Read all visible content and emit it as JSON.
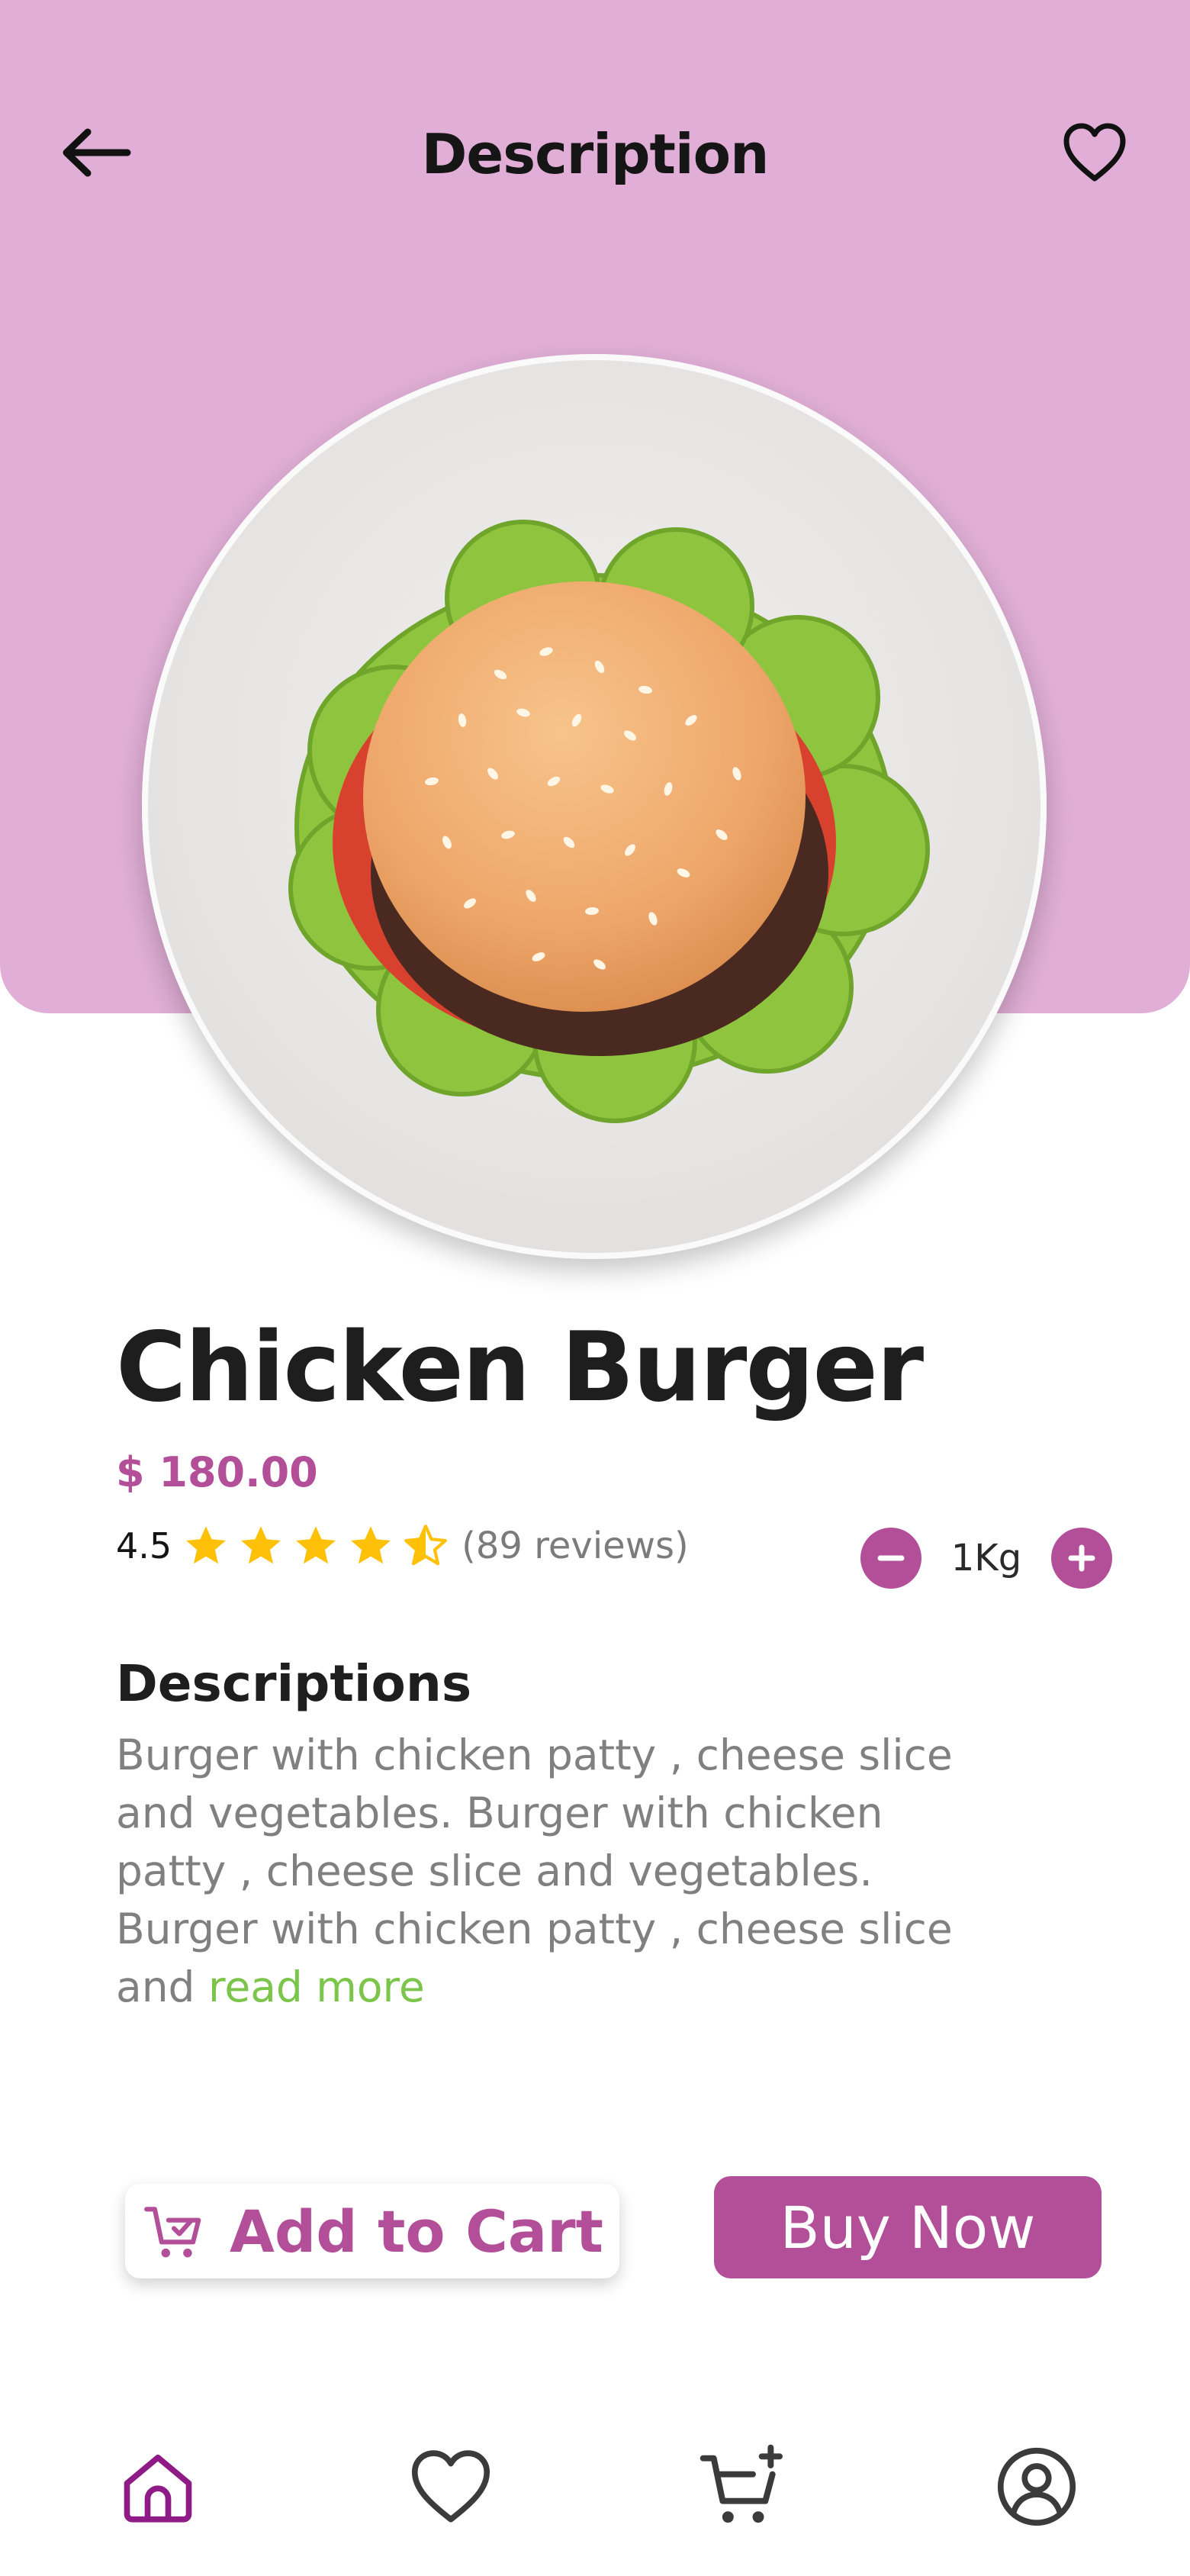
{
  "header": {
    "title": "Description",
    "back_icon": "arrow-left-icon",
    "favorite_icon": "heart-outline-icon"
  },
  "product": {
    "name": "Chicken Burger",
    "price": "$ 180.00",
    "rating": "4.5",
    "rating_stars": 4.5,
    "reviews": "(89 reviews)",
    "quantity": "1Kg"
  },
  "description": {
    "heading": "Descriptions",
    "text": "Burger with chicken patty , cheese slice and vegetables. Burger with chicken patty , cheese slice and vegetables. Burger with chicken patty , cheese slice and",
    "read_more": "read more"
  },
  "actions": {
    "add_to_cart": "Add to Cart",
    "buy_now": "Buy Now"
  },
  "bottom_nav": [
    {
      "icon": "home-icon",
      "active": true
    },
    {
      "icon": "heart-icon",
      "active": false
    },
    {
      "icon": "cart-add-icon",
      "active": false
    },
    {
      "icon": "profile-icon",
      "active": false
    }
  ],
  "colors": {
    "accent": "#b24f98",
    "hero_background": "#e0aed6",
    "star": "#ffc107",
    "read_more": "#7bc54a",
    "nav_active": "#8e1b86",
    "nav_inactive": "#3b3b3b"
  }
}
